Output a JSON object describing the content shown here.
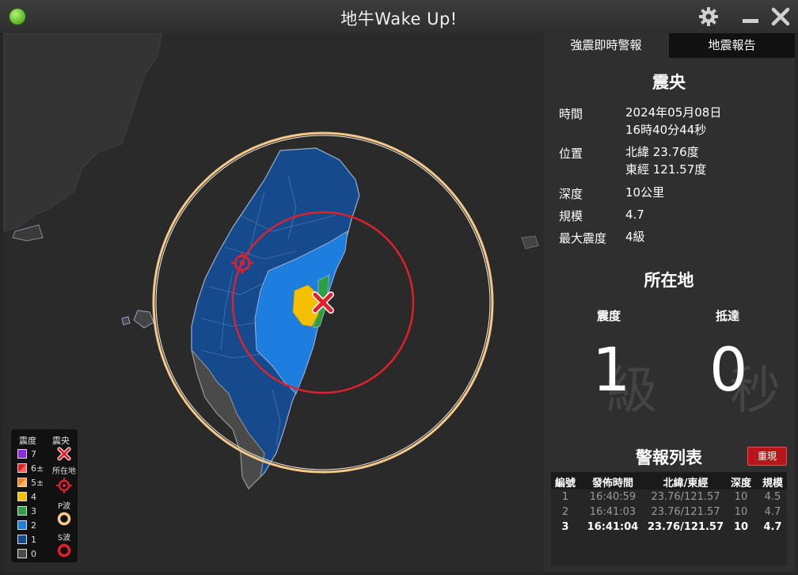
{
  "window": {
    "title": "地牛Wake Up!"
  },
  "titlebar": {
    "settings_icon": "gear-icon",
    "minimize_icon": "minimize-icon",
    "close_icon": "close-icon"
  },
  "legend": {
    "intensity_header": "震度",
    "epicenter_header": "震央",
    "location_header": "所在地",
    "p_wave_header": "P波",
    "s_wave_header": "S波",
    "levels": [
      {
        "label": "7",
        "color": "#8a2be2"
      },
      {
        "label": "6±",
        "color": "#e02020"
      },
      {
        "label": "5±",
        "color": "#f08020"
      },
      {
        "label": "4",
        "color": "#f5c000"
      },
      {
        "label": "3",
        "color": "#2ea043"
      },
      {
        "label": "2",
        "color": "#1e7ee0"
      },
      {
        "label": "1",
        "color": "#154a8c"
      },
      {
        "label": "0",
        "color": "#4a4a4a"
      }
    ]
  },
  "tabs": [
    {
      "label": "強震即時警報",
      "active": true
    },
    {
      "label": "地震報告",
      "active": false
    }
  ],
  "epicenter": {
    "title": "震央",
    "time_label": "時間",
    "time_date": "2024年05月08日",
    "time_clock": "16時40分44秒",
    "position_label": "位置",
    "lat": "北緯 23.76度",
    "lon": "東經 121.57度",
    "depth_label": "深度",
    "depth": "10公里",
    "magnitude_label": "規模",
    "magnitude": "4.7",
    "max_intensity_label": "最大震度",
    "max_intensity": "4級"
  },
  "location": {
    "title": "所在地",
    "intensity_label": "震度",
    "arrival_label": "抵達",
    "intensity_value": "1",
    "intensity_unit": "級",
    "arrival_value": "0",
    "arrival_unit": "秒"
  },
  "alerts": {
    "title": "警報列表",
    "reset_button": "重現",
    "headers": [
      "編號",
      "發佈時間",
      "北緯/東經",
      "深度",
      "規模"
    ],
    "rows": [
      [
        "1",
        "16:40:59",
        "23.76/121.57",
        "10",
        "4.5"
      ],
      [
        "2",
        "16:41:03",
        "23.76/121.57",
        "10",
        "4.7"
      ],
      [
        "3",
        "16:41:04",
        "23.76/121.57",
        "10",
        "4.7"
      ]
    ]
  },
  "colors": {
    "p_wave": "#f5c98a",
    "s_wave": "#e0202a",
    "reset_button": "#b8161a"
  }
}
